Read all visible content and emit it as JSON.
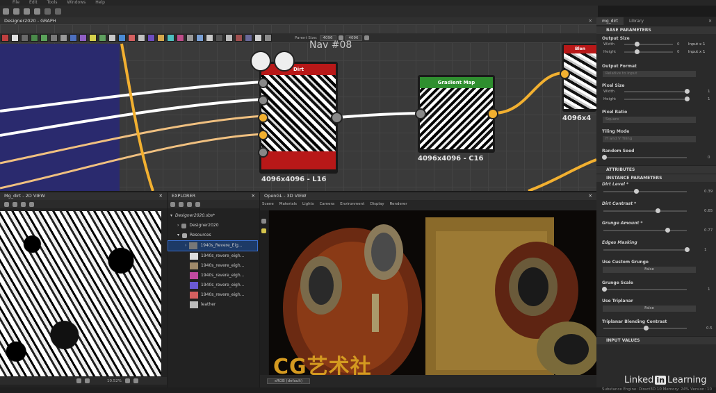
{
  "menu": [
    "File",
    "Edit",
    "Tools",
    "Windows",
    "Help"
  ],
  "graph_panel": {
    "title": "Designer2020 - GRAPH",
    "parent_size_label": "Parent Size:",
    "parent_size_value": "4096",
    "size_value": "4096",
    "frame_title": "Nav #08"
  },
  "nodes": {
    "dirt": {
      "title": "Dirt",
      "label": "4096x4096 - L16",
      "color": "#b81818"
    },
    "gradient_map": {
      "title": "Gradient Map",
      "label": "4096x4096 - C16",
      "color": "#2f8f2f"
    },
    "partial": {
      "title": "Blen",
      "label": "4096x4"
    }
  },
  "view2d": {
    "title": "Mg_dirt - 2D VIEW",
    "zoom": "10.52%"
  },
  "explorer": {
    "title": "EXPLORER",
    "items": [
      {
        "label": "Designer2020.sbs*",
        "level": 0
      },
      {
        "label": "Designer2020",
        "level": 1
      },
      {
        "label": "Resources",
        "level": 1
      },
      {
        "label": "1940s_Revere_Eig...",
        "level": 2,
        "selected": true
      },
      {
        "label": "1940s_revere_eigh...",
        "level": 2
      },
      {
        "label": "1940s_revere_eigh...",
        "level": 2
      },
      {
        "label": "1940s_revere_eigh...",
        "level": 2
      },
      {
        "label": "1940s_revere_eigh...",
        "level": 2
      },
      {
        "label": "1940s_revere_eigh...",
        "level": 2
      },
      {
        "label": "leather",
        "level": 2
      }
    ]
  },
  "view3d": {
    "title": "OpenGL - 3D VIEW",
    "menu": [
      "Scene",
      "Materials",
      "Lights",
      "Camera",
      "Environment",
      "Display",
      "Renderer"
    ],
    "bottom_dropdown": "sRGB (default)"
  },
  "right_panel": {
    "tabs": [
      "mg_dirt",
      "Library"
    ],
    "base_parameters": "BASE PARAMETERS",
    "output_size": {
      "label": "Output Size",
      "width_label": "Width",
      "height_label": "Height",
      "width_val": "0",
      "height_val": "0",
      "width_mode": "Input x 1",
      "height_mode": "Input x 1"
    },
    "output_format": {
      "label": "Output Format",
      "value": "Relative to input"
    },
    "pixel_size": {
      "label": "Pixel Size",
      "width_label": "Width",
      "height_label": "Height",
      "width_val": "1",
      "height_val": "1"
    },
    "pixel_ratio": {
      "label": "Pixel Ratio",
      "value": "Square"
    },
    "tiling_mode": {
      "label": "Tiling Mode",
      "value": "H and V Tiling"
    },
    "random_seed": {
      "label": "Random Seed",
      "value": "0"
    },
    "attributes": "ATTRIBUTES",
    "instance_parameters": "INSTANCE PARAMETERS",
    "params": [
      {
        "label": "Dirt Level *",
        "value": "0.39",
        "pos": 0.39
      },
      {
        "label": "Dirt Contrast *",
        "value": "0.65",
        "pos": 0.65
      },
      {
        "label": "Grunge Amount *",
        "value": "0.77",
        "pos": 0.77
      },
      {
        "label": "Edges Masking",
        "value": "1",
        "pos": 1
      }
    ],
    "use_custom_grunge": {
      "label": "Use Custom Grunge",
      "value": "False"
    },
    "grunge_scale": {
      "label": "Grunge Scale",
      "value": "1",
      "pos": 0
    },
    "use_triplanar": {
      "label": "Use Triplanar",
      "value": "False"
    },
    "triplanar_contrast": {
      "label": "Triplanar Blending Contrast",
      "value": "0.5",
      "pos": 0.5
    },
    "input_values": "INPUT VALUES"
  },
  "status": {
    "text": "Substance Engine: Direct3D 10   Memory: 24%   Version: 10"
  },
  "watermarks": {
    "cg": "CG艺术社",
    "linkedin": "Linked",
    "learning": "Learning",
    "in": "in"
  }
}
